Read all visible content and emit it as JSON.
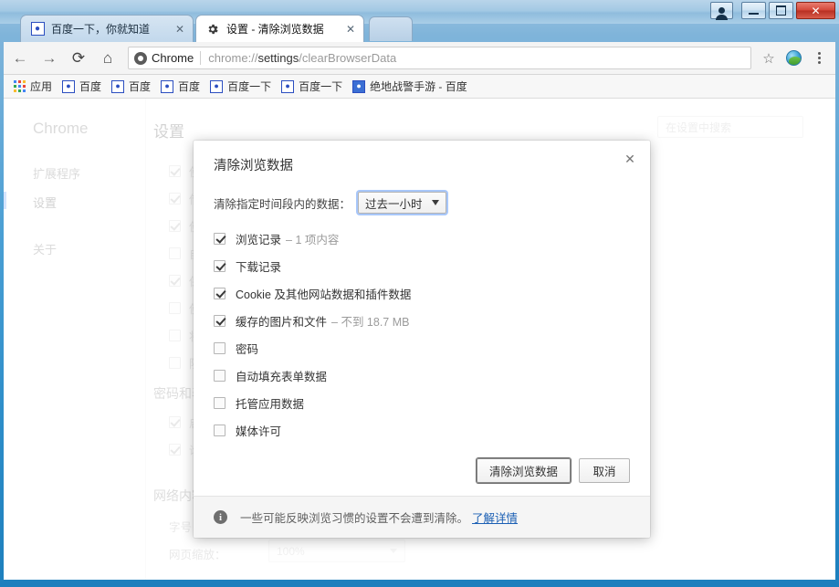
{
  "window": {
    "controls": {
      "user_label": "user-account",
      "minimize_label": "Minimize",
      "maximize_label": "Maximize",
      "close_label": "✕"
    }
  },
  "tabs": [
    {
      "title": "百度一下，你就知道",
      "favicon": "baidu-paw-icon",
      "active": false,
      "close_label": "✕"
    },
    {
      "title": "设置 - 清除浏览数据",
      "favicon": "gear-icon",
      "active": true,
      "close_label": "✕"
    }
  ],
  "toolbar": {
    "back_glyph": "←",
    "forward_glyph": "→",
    "reload_glyph": "⟳",
    "home_glyph": "⌂",
    "chip_label": "Chrome",
    "url_prefix": "chrome://",
    "url_bold": "settings",
    "url_suffix": "/clearBrowserData",
    "star_glyph": "☆"
  },
  "bookmarks": [
    {
      "label": "应用",
      "icon": "apps-grid-icon"
    },
    {
      "label": "百度",
      "icon": "baidu-paw-icon"
    },
    {
      "label": "百度",
      "icon": "baidu-paw-icon"
    },
    {
      "label": "百度",
      "icon": "baidu-paw-icon"
    },
    {
      "label": "百度一下",
      "icon": "baidu-paw-icon"
    },
    {
      "label": "百度一下",
      "icon": "baidu-paw-icon"
    },
    {
      "label": "绝地战警手游 - 百度",
      "icon": "baidu-bear-icon"
    }
  ],
  "settings": {
    "brand": "Chrome",
    "nav": [
      {
        "label": "扩展程序",
        "selected": false
      },
      {
        "label": "设置",
        "selected": true
      },
      {
        "label": "关于",
        "selected": false
      }
    ],
    "page_title": "设置",
    "search_placeholder": "在设置中搜索",
    "sections": [
      {
        "label": "密码和表单"
      },
      {
        "label": "网络内容"
      }
    ],
    "bg_rows": [
      {
        "checked": true,
        "text": "使"
      },
      {
        "checked": true,
        "text": "借"
      },
      {
        "checked": true,
        "text": "使"
      },
      {
        "checked": false,
        "text": "自"
      },
      {
        "checked": true,
        "text": "保"
      },
      {
        "checked": false,
        "text": "使"
      },
      {
        "checked": false,
        "text": "将"
      },
      {
        "checked": false,
        "text": "阻"
      }
    ],
    "pw_rows": [
      {
        "checked": true,
        "text": "启"
      },
      {
        "checked": true,
        "text": "询"
      }
    ],
    "font_label": "字号",
    "zoom_label": "网页缩放：",
    "zoom_value": "100%"
  },
  "dialog": {
    "title": "清除浏览数据",
    "close_glyph": "✕",
    "period_label": "清除指定时间段内的数据：",
    "period_value": "过去一小时",
    "options": [
      {
        "label": "浏览记录",
        "sub": "–  1 项内容",
        "checked": true
      },
      {
        "label": "下载记录",
        "sub": "",
        "checked": true
      },
      {
        "label": "Cookie 及其他网站数据和插件数据",
        "sub": "",
        "checked": true
      },
      {
        "label": "缓存的图片和文件",
        "sub": "–  不到 18.7 MB",
        "checked": true
      },
      {
        "label": "密码",
        "sub": "",
        "checked": false
      },
      {
        "label": "自动填充表单数据",
        "sub": "",
        "checked": false
      },
      {
        "label": "托管应用数据",
        "sub": "",
        "checked": false
      },
      {
        "label": "媒体许可",
        "sub": "",
        "checked": false
      }
    ],
    "confirm_label": "清除浏览数据",
    "cancel_label": "取消",
    "info_text": "一些可能反映浏览习惯的设置不会遭到清除。",
    "info_link": "了解详情"
  }
}
